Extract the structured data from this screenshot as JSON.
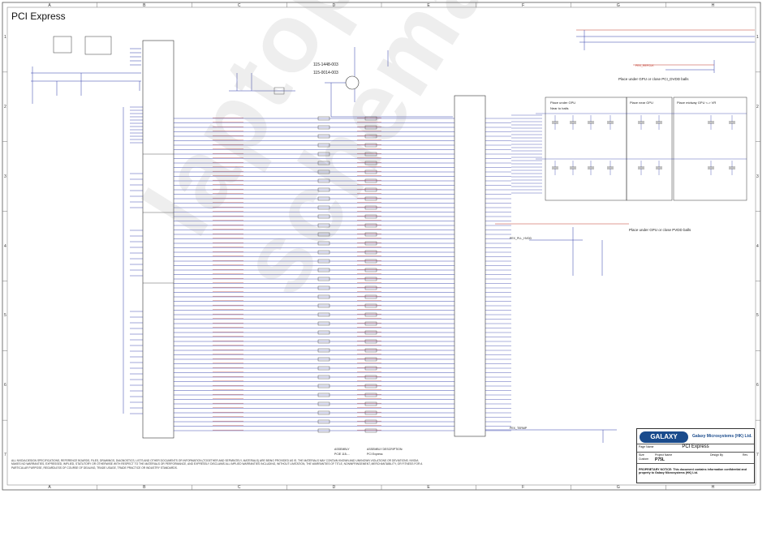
{
  "page": {
    "title": "PCI Express",
    "watermark": "laptop-schematics.ru"
  },
  "frame": {
    "col_labels": [
      "A",
      "B",
      "C",
      "D",
      "E",
      "F",
      "G",
      "H"
    ],
    "row_labels": [
      "1",
      "2",
      "3",
      "4",
      "5",
      "6",
      "7"
    ]
  },
  "annotations": {
    "part_num_1": "115-1448-003",
    "part_num_2": "115-0014-003",
    "pdvdd_note": "Place under GPU or close PCI_DVDD balls",
    "pvdd_note": "Place under GPU or close PVDD balls",
    "box_under_gpu": "Place under GPU",
    "box_near_balls": "Near to balls",
    "box_rear_gpu": "Place near GPU",
    "box_midway": "Place midway GPU <-> VR",
    "assembly_label": "ASSEMBLY",
    "assembly_desc": "ASSEMBLY DESCRIPTION:",
    "assembly_val": "PCIE 115-...",
    "assembly_desc_val": "PCI Express",
    "pex_refclk_label": "PEX_REFCLK",
    "pvdd_label": "PEX_PLL_HVDD",
    "pex_terms": "PEX_TERMP"
  },
  "title_block": {
    "company": "Galaxy Microsystems (HK) Ltd.",
    "logo_text": "GALAXY",
    "page_name_label": "Page Name",
    "page_name": "PCI Express",
    "size_label": "Size",
    "size": "Custom",
    "project_label": "Project Name",
    "project": "P75L",
    "design_label": "Design By",
    "rev_label": "Rev",
    "confidential": "PROPRIETARY NOTICE: This document contains information confidential and property to Galaxy Microsystems (HK) Ltd."
  },
  "disclaimer": "ALL NVIDIA DESIGN SPECIFICATIONS, REFERENCE BOARDS, FILES, DRAWINGS, DIAGNOSTICS, LISTS AND OTHER DOCUMENTS OR INFORMATION (TOGETHER AND SEPARATELY, MATERIALS) ARE BEING PROVIDED AS IS. THE MATERIALS MAY CONTAIN KNOWN AND UNKNOWN VIOLATIONS OR DEVIATIONS. NVIDIA MAKES NO WARRANTIES, EXPRESSED, IMPLIED, STATUTORY OR OTHERWISE WITH RESPECT TO THE MATERIALS OR PERFORMANCE, AND EXPRESSLY DISCLAIMS ALL IMPLIED WARRANTIES INCLUDING, WITHOUT LIMITATION, THE WARRANTIES OF TITLE, NONINFRINGEMENT, MERCHANTABILITY, OR FITNESS FOR A PARTICULAR PURPOSE, REGARDLESS OF COURSE OF DEALING, TRADE USAGE, TRADE PRACTICE OR INDUSTRY STANDARDS.",
  "colors": {
    "wire": "#2e3aa8",
    "net_red": "#c0392b",
    "pin_blue": "#1f3fa0",
    "frame": "#555555",
    "box": "#333333"
  }
}
